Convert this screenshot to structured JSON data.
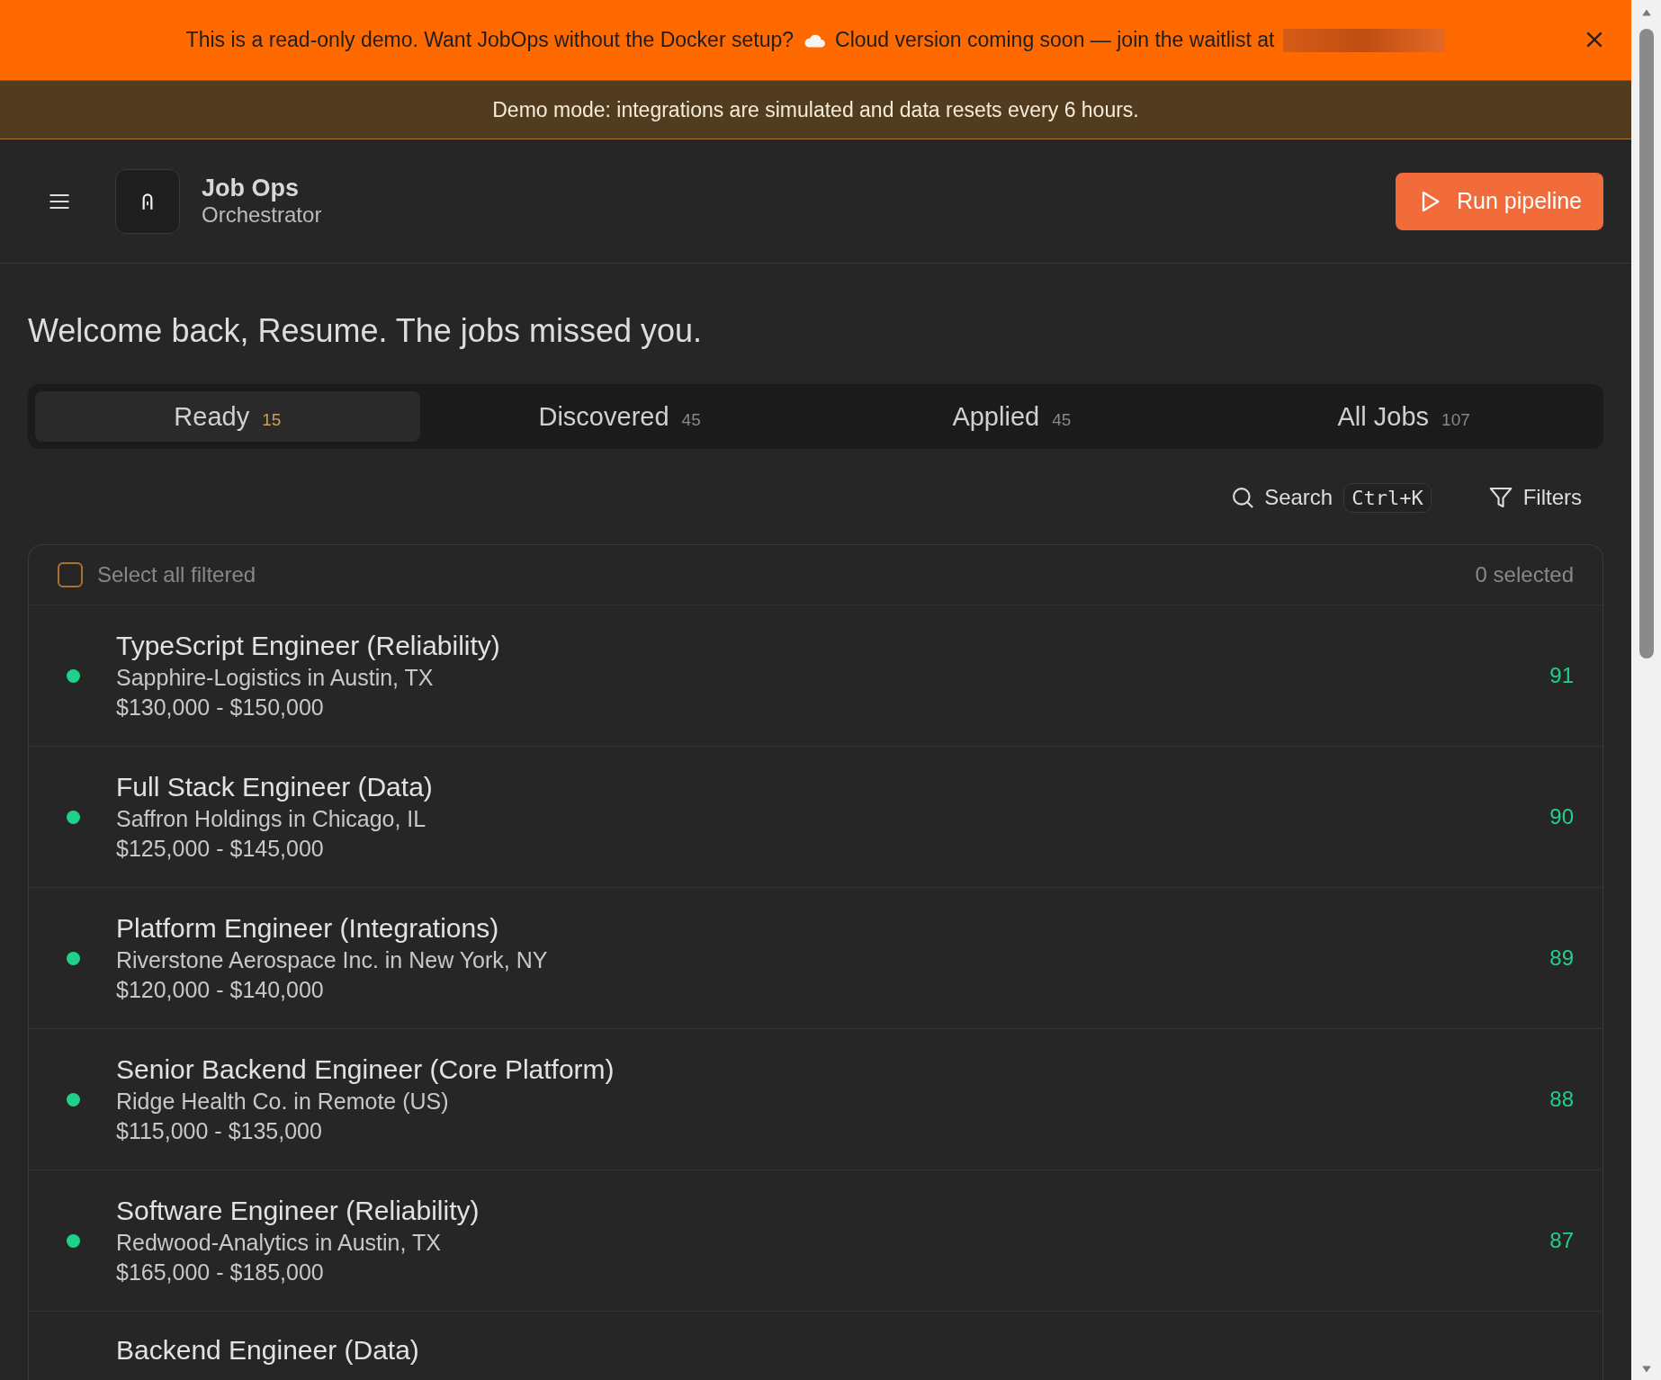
{
  "promo_banner": {
    "text_before": "This is a read-only demo. Want JobOps without the Docker setup?",
    "text_after": "Cloud version coming soon — join the waitlist at",
    "redacted": true
  },
  "demo_notice": "Demo mode: integrations are simulated and data resets every 6 hours.",
  "header": {
    "title": "Job Ops",
    "subtitle": "Orchestrator",
    "action": "Run pipeline"
  },
  "greeting": "Welcome back, Resume. The jobs missed you.",
  "tabs": [
    {
      "label": "Ready",
      "count": "15",
      "selected": true
    },
    {
      "label": "Discovered",
      "count": "45",
      "selected": false
    },
    {
      "label": "Applied",
      "count": "45",
      "selected": false
    },
    {
      "label": "All Jobs",
      "count": "107",
      "selected": false
    }
  ],
  "toolbar": {
    "search": "Search",
    "shortcut": "Ctrl+K",
    "filters": "Filters"
  },
  "list": {
    "select_all": "Select all filtered",
    "select_all_checked": false,
    "selected_count": "0 selected",
    "jobs": [
      {
        "title": "TypeScript Engineer (Reliability)",
        "company": "Sapphire-Logistics in Austin, TX",
        "salary": "$130,000 - $150,000",
        "score": "91"
      },
      {
        "title": "Full Stack Engineer (Data)",
        "company": "Saffron Holdings in Chicago, IL",
        "salary": "$125,000 - $145,000",
        "score": "90"
      },
      {
        "title": "Platform Engineer (Integrations)",
        "company": "Riverstone Aerospace Inc. in New York, NY",
        "salary": "$120,000 - $140,000",
        "score": "89"
      },
      {
        "title": "Senior Backend Engineer (Core Platform)",
        "company": "Ridge Health Co. in Remote (US)",
        "salary": "$115,000 - $135,000",
        "score": "88"
      },
      {
        "title": "Software Engineer (Reliability)",
        "company": "Redwood-Analytics in Austin, TX",
        "salary": "$165,000 - $185,000",
        "score": "87"
      },
      {
        "title": "Backend Engineer (Data)"
      }
    ]
  }
}
